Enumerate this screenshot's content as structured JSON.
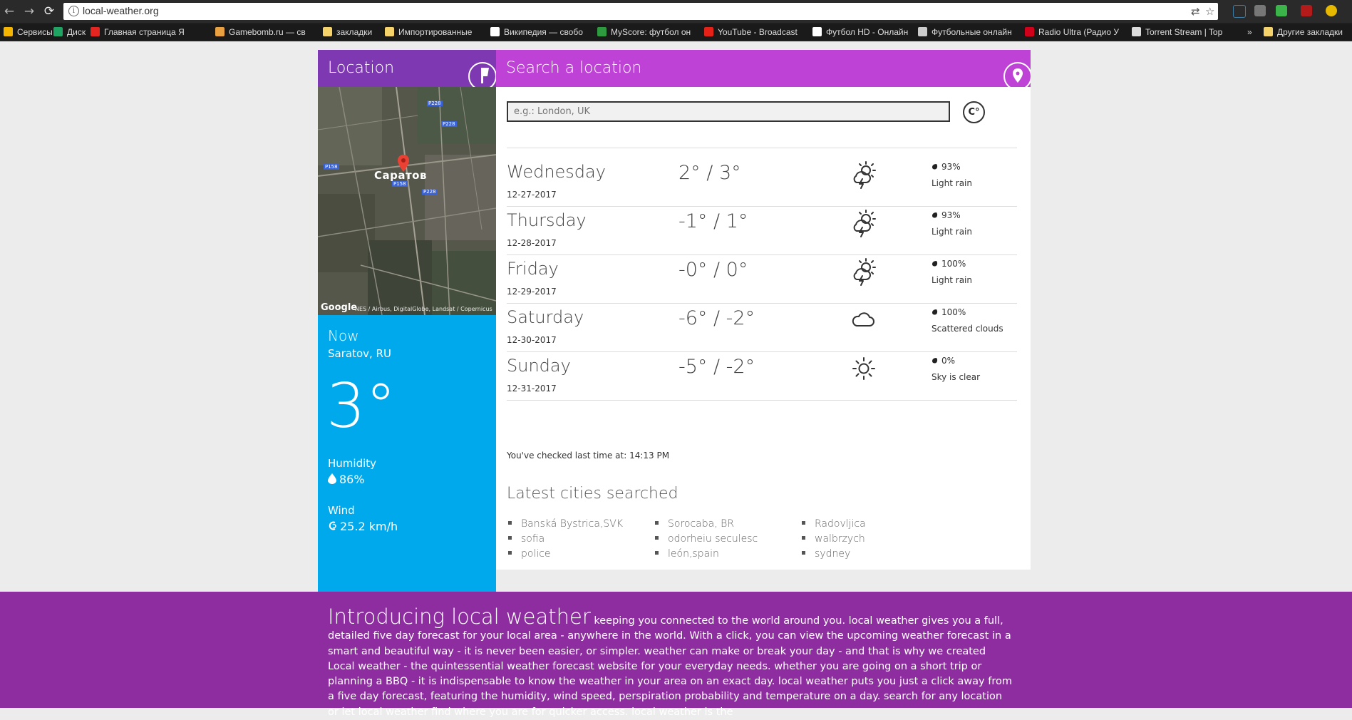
{
  "browser": {
    "url": "local-weather.org",
    "bookmarks": [
      {
        "label": "Сервисы",
        "color": "#f4b400"
      },
      {
        "label": "Диск",
        "color": "#1fa463"
      },
      {
        "label": "Главная страница Я",
        "color": "#e52620"
      },
      {
        "label": "Gamebomb.ru — св",
        "color": "#e8a040"
      },
      {
        "label": "закладки",
        "color": "#f5d36a"
      },
      {
        "label": "Импортированные",
        "color": "#f5d36a"
      },
      {
        "label": "Википедия — свобо",
        "color": "#ffffff"
      },
      {
        "label": "MyScore: футбол он",
        "color": "#2e9a3f"
      },
      {
        "label": "YouTube - Broadcast",
        "color": "#e62117"
      },
      {
        "label": "Футбол HD - Онлайн",
        "color": "#ffffff"
      },
      {
        "label": "Футбольные онлайн",
        "color": "#cccccc"
      },
      {
        "label": "Radio Ultra (Радио У",
        "color": "#d0021b"
      },
      {
        "label": "Torrent Stream | Top",
        "color": "#dddddd"
      },
      {
        "label": "»",
        "color": ""
      },
      {
        "label": "Другие закладки",
        "color": "#f5d36a"
      }
    ]
  },
  "sidebar": {
    "header_title": "Location",
    "map_city_label": "Саратов",
    "map_attribution": "Google",
    "map_copyright": "NES / Airbus, DigitalGlobe, Landsat / Copernicus",
    "map_road_labels": [
      "P228",
      "P228",
      "P158",
      "P158",
      "P228"
    ],
    "now_label": "Now",
    "city": "Saratov, RU",
    "temperature": "3°",
    "humidity_label": "Humidity",
    "humidity_value": "86%",
    "wind_label": "Wind",
    "wind_value": "25.2 km/h"
  },
  "search": {
    "header_title": "Search a location",
    "placeholder": "e.g.: London, UK",
    "unit_toggle": "C°"
  },
  "forecast": [
    {
      "day": "Wednesday",
      "date": "12-27-2017",
      "temp": "2° / 3°",
      "icon": "sun-cloud-lightning-icon",
      "humidity": "93%",
      "desc": "Light rain"
    },
    {
      "day": "Thursday",
      "date": "12-28-2017",
      "temp": "-1° / 1°",
      "icon": "sun-cloud-lightning-icon",
      "humidity": "93%",
      "desc": "Light rain"
    },
    {
      "day": "Friday",
      "date": "12-29-2017",
      "temp": "-0° / 0°",
      "icon": "sun-cloud-lightning-icon",
      "humidity": "100%",
      "desc": "Light rain"
    },
    {
      "day": "Saturday",
      "date": "12-30-2017",
      "temp": "-6° / -2°",
      "icon": "cloud-icon",
      "humidity": "100%",
      "desc": "Scattered clouds"
    },
    {
      "day": "Sunday",
      "date": "12-31-2017",
      "temp": "-5° / -2°",
      "icon": "sun-icon",
      "humidity": "0%",
      "desc": "Sky is clear"
    }
  ],
  "last_checked": "You've checked last time at: 14:13 PM",
  "latest": {
    "title": "Latest cities searched",
    "cities": [
      [
        "Banská Bystrica,SVK",
        "sofia",
        "police"
      ],
      [
        "Sorocaba, BR",
        "odorheiu seculesc",
        "león,spain"
      ],
      [
        "Radovljica",
        "walbrzych",
        "sydney"
      ]
    ]
  },
  "intro": {
    "heading": "Introducing local weather",
    "body": " keeping you connected to the world around you. local weather gives you a full, detailed five day forecast for your local area - anywhere in the world. With a click, you can view the upcoming weather forecast in a smart and beautiful way - it is never been easier, or simpler. weather can make or break your day - and that is why we created Local weather - the quintessential weather forecast website for your everyday needs. whether you are going on a short trip or planning a BBQ - it is indispensable to know the weather in your area on an exact day. local weather puts you just a click away from a five day forecast, featuring the humidity, wind speed, perspiration probability and temperature on a day. search for any location or let local weather find where you are for quicker access. local weather is the"
  },
  "colors": {
    "location_header": "#7e39b2",
    "search_header": "#bf42d6",
    "now_panel": "#00a8ec",
    "intro_band": "#8e2da0"
  }
}
